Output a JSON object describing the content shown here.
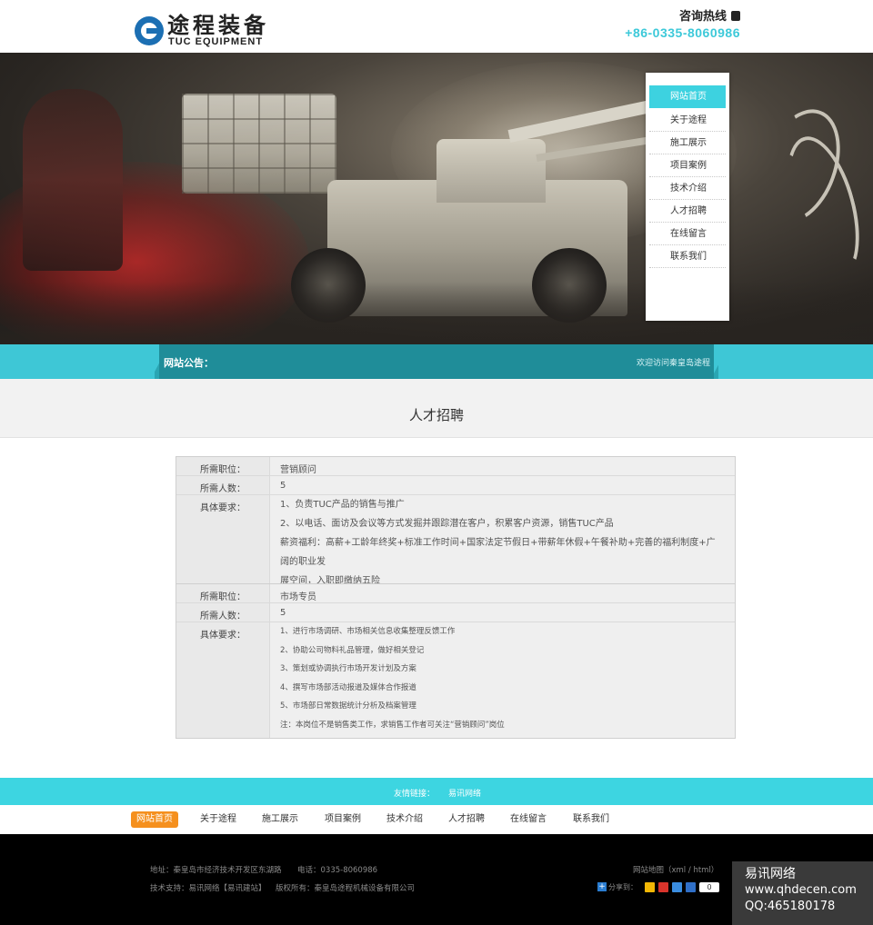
{
  "header": {
    "logo_cn": "途程装备",
    "logo_en": "TUC EQUIPMENT",
    "hotline_label": "咨询热线",
    "hotline_number": "+86-0335-8060986"
  },
  "side_nav": {
    "items": [
      {
        "label": "网站首页",
        "active": true
      },
      {
        "label": "关于途程",
        "active": false
      },
      {
        "label": "施工展示",
        "active": false
      },
      {
        "label": "项目案例",
        "active": false
      },
      {
        "label": "技术介绍",
        "active": false
      },
      {
        "label": "人才招聘",
        "active": false
      },
      {
        "label": "在线留言",
        "active": false
      },
      {
        "label": "联系我们",
        "active": false
      }
    ]
  },
  "notice": {
    "label": "网站公告：",
    "text": "欢迎访问秦皇岛途程"
  },
  "page": {
    "title": "人才招聘"
  },
  "jobs": [
    {
      "position_key": "所需职位：",
      "position": "营销顾问",
      "count_key": "所需人数：",
      "count": "5",
      "req_key": "具体要求：",
      "requirements": [
        "1、负责TUC产品的销售与推广",
        "2、以电话、面访及会议等方式发掘并跟踪潜在客户，积累客户资源，销售TUC产品",
        "薪资福利：高薪+工龄年终奖+标准工作时间+国家法定节假日+带薪年休假+午餐补助+完善的福利制度+广阔的职业发",
        "展空间，入职即缴纳五险"
      ]
    },
    {
      "position_key": "所需职位：",
      "position": "市场专员",
      "count_key": "所需人数：",
      "count": "5",
      "req_key": "具体要求：",
      "requirements": [
        "1、进行市场调研、市场相关信息收集整理反馈工作",
        "2、协助公司物料礼品管理，做好相关登记",
        "3、策划或协调执行市场开发计划及方案",
        "4、撰写市场部活动报道及媒体合作报道",
        "5、市场部日常数据统计分析及档案管理",
        "注：本岗位不是销售类工作，求销售工作者可关注“营销顾问”岗位"
      ]
    }
  ],
  "friend_links": {
    "label": "友情链接：",
    "link": "易讯网络"
  },
  "footer_nav": {
    "items": [
      "网站首页",
      "关于途程",
      "施工展示",
      "项目案例",
      "技术介绍",
      "人才招聘",
      "在线留言",
      "联系我们"
    ]
  },
  "footer": {
    "address": "地址：秦皇岛市经济技术开发区东湖路",
    "phone": "电话：0335-8060986",
    "support": "技术支持：易讯网络【易讯建站】",
    "copyright": "版权所有：秦皇岛途程机械设备有限公司",
    "sitemap": "网站地图（xml / html）",
    "share_label": "分享到：",
    "share_count": "0"
  },
  "watermark": {
    "name": "易讯网络",
    "url": "www.qhdecen.com",
    "qq": "QQ:465180178"
  },
  "colors": {
    "accent": "#3dd2e0",
    "notice_dark": "#1f8d99",
    "footer_active": "#f5901e",
    "hotline": "#3dc9d9"
  }
}
